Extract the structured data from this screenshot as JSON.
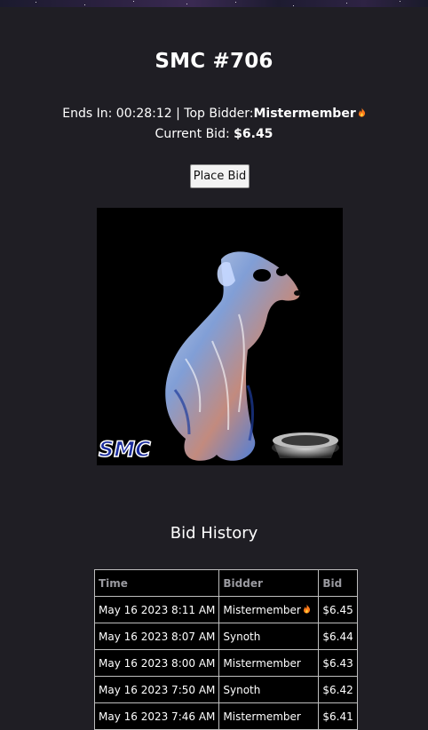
{
  "auction": {
    "title": "SMC #706",
    "ends_label": "Ends In:",
    "ends_value": "00:28:12",
    "separator": "|",
    "top_bidder_label": "Top Bidder:",
    "top_bidder": "Mistermember",
    "top_bidder_badge": "fire-icon",
    "current_bid_label": "Current Bid:",
    "current_bid": "$6.45",
    "place_bid_label": "Place Bid",
    "image_watermark": "SMC"
  },
  "history": {
    "title": "Bid History",
    "columns": [
      "Time",
      "Bidder",
      "Bid"
    ],
    "rows": [
      {
        "time": "May 16 2023 8:11 AM",
        "bidder": "Mistermember",
        "fire": true,
        "bid": "$6.45"
      },
      {
        "time": "May 16 2023 8:07 AM",
        "bidder": "Synoth",
        "fire": false,
        "bid": "$6.44"
      },
      {
        "time": "May 16 2023 8:00 AM",
        "bidder": "Mistermember",
        "fire": false,
        "bid": "$6.43"
      },
      {
        "time": "May 16 2023 7:50 AM",
        "bidder": "Synoth",
        "fire": false,
        "bid": "$6.42"
      },
      {
        "time": "May 16 2023 7:46 AM",
        "bidder": "Mistermember",
        "fire": false,
        "bid": "$6.41"
      }
    ]
  },
  "colors": {
    "background": "#1f1e24",
    "table_background": "#000000",
    "header_text": "#9a9aa0",
    "fire": "#ff7a1a"
  }
}
